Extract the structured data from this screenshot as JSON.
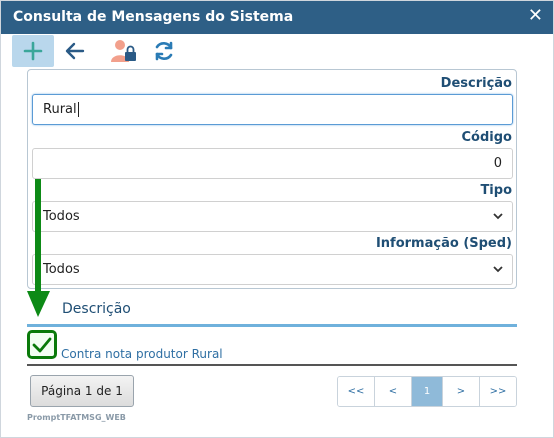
{
  "window": {
    "title": "Consulta de Mensagens do Sistema",
    "close": "✕"
  },
  "toolbar": {
    "add_icon": "plus-icon",
    "back_icon": "arrow-left-icon",
    "user_lock_icon": "user-lock-icon",
    "refresh_icon": "refresh-icon"
  },
  "form": {
    "descricao_label": "Descrição",
    "descricao_value": "Rural",
    "codigo_label": "Código",
    "codigo_value": "0",
    "tipo_label": "Tipo",
    "tipo_value": "Todos",
    "info_label": "Informação (Sped)",
    "info_value": "Todos"
  },
  "grid": {
    "header": "Descrição",
    "rows": [
      {
        "descricao": "Contra nota produtor Rural"
      }
    ]
  },
  "pager": {
    "info": "Página 1 de 1",
    "first": "<<",
    "prev": "<",
    "current": "1",
    "next": ">",
    "last": ">>"
  },
  "footer": {
    "code": "PromptTFATMSG_WEB"
  },
  "colors": {
    "titlebar": "#2e5f86",
    "accent": "#6fb1dc",
    "check_green": "#0a7a0a"
  }
}
